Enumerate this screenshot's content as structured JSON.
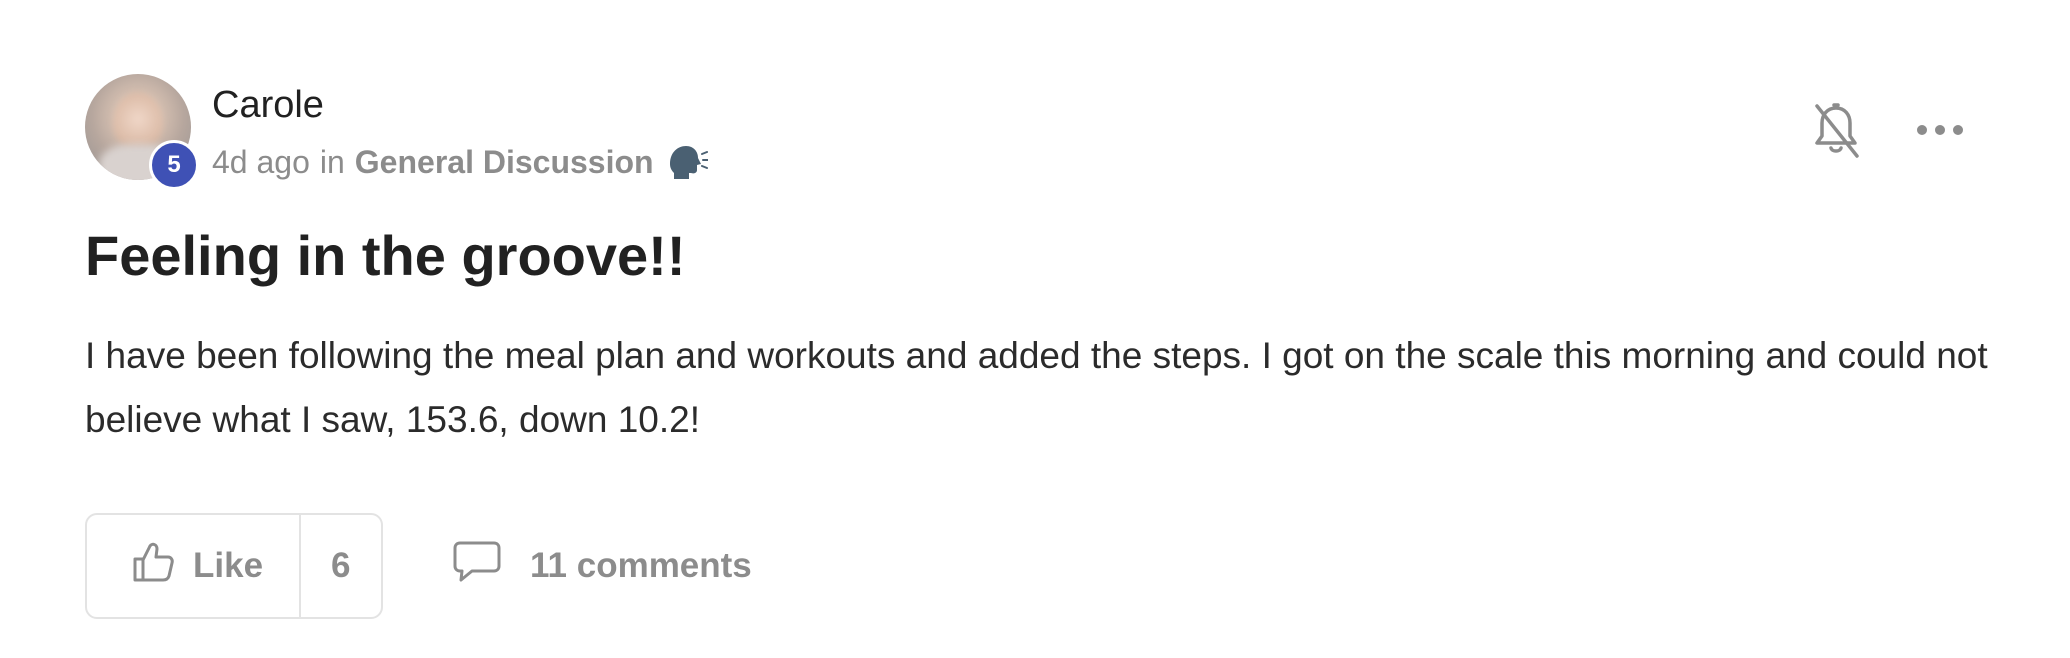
{
  "post": {
    "author": {
      "name": "Carole",
      "level": "5"
    },
    "meta": {
      "time_ago": "4d ago",
      "in_word": "in",
      "category": "General Discussion",
      "category_icon": "speaking-head-icon"
    },
    "title": "Feeling in the groove!!",
    "body": "I have been following the meal plan and workouts and added the steps. I got on the scale this morning and could not believe what I saw, 153.6, down 10.2!",
    "actions": {
      "like_label": "Like",
      "like_count": "6",
      "comments_label": "11 comments"
    },
    "header_icons": [
      "bell-off-icon",
      "more-icon"
    ]
  },
  "colors": {
    "badge": "#3f51b5",
    "muted_text": "#8c8c8c",
    "primary_text": "#212121",
    "border": "#e3e3e3"
  }
}
